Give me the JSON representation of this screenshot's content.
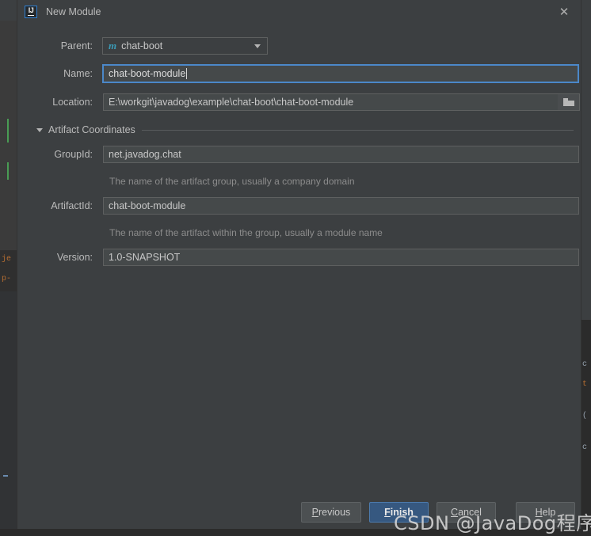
{
  "window": {
    "title": "New Module",
    "logo_icon": "intellij-idea-logo",
    "close_icon": "close-icon"
  },
  "form": {
    "parent": {
      "label": "Parent:",
      "value": "chat-boot",
      "icon": "maven-module-icon",
      "icon_glyph": "m",
      "dropdown_icon": "chevron-down-icon"
    },
    "name": {
      "label": "Name:",
      "value": "chat-boot-module",
      "focused": true
    },
    "location": {
      "label": "Location:",
      "value": "E:\\workgit\\javadog\\example\\chat-boot\\chat-boot-module",
      "browse_icon": "folder-icon"
    }
  },
  "artifact_section": {
    "title": "Artifact Coordinates",
    "collapse_icon": "triangle-down-icon",
    "group_id": {
      "label": "GroupId:",
      "value": "net.javadog.chat",
      "hint": "The name of the artifact group, usually a company domain"
    },
    "artifact_id": {
      "label": "ArtifactId:",
      "value": "chat-boot-module",
      "hint": "The name of the artifact within the group, usually a module name"
    },
    "version": {
      "label": "Version:",
      "value": "1.0-SNAPSHOT"
    }
  },
  "buttons": {
    "previous": {
      "prefix": "",
      "mnemonic": "P",
      "suffix": "revious"
    },
    "finish": {
      "prefix": "",
      "mnemonic": "F",
      "suffix": "inish"
    },
    "cancel": {
      "prefix": "",
      "mnemonic": "C",
      "suffix": "ancel"
    },
    "help": {
      "prefix": "",
      "mnemonic": "H",
      "suffix": "elp"
    }
  },
  "watermark": {
    "text": "CSDN @JavaDog程序狗"
  },
  "background": {
    "left_fragments": [
      "je",
      "p-"
    ],
    "right_fragments": [
      "c",
      "t",
      "(",
      "c"
    ]
  },
  "colors": {
    "dialog_bg": "#3c3f41",
    "field_bg": "#45494a",
    "focus_border": "#4b88c9",
    "default_button": "#365880",
    "maven_icon": "#3b9ab5",
    "label_text": "#bbbbbb",
    "hint_text": "#8c8c8c"
  }
}
